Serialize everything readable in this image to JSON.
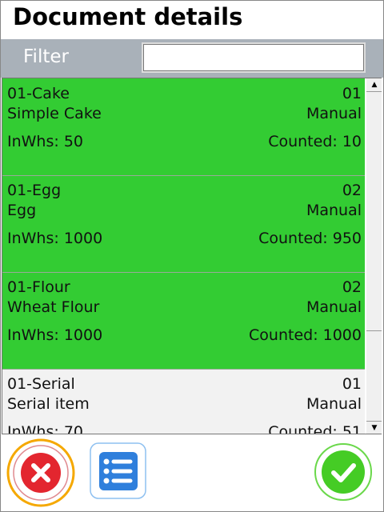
{
  "title": "Document details",
  "filter": {
    "label": "Filter",
    "value": ""
  },
  "items": [
    {
      "code": "01-Cake",
      "name": "Simple Cake",
      "num": "01",
      "mode": "Manual",
      "inwhs": "InWhs: 50",
      "counted": "Counted: 10",
      "bg": "#33cc33"
    },
    {
      "code": "01-Egg",
      "name": "Egg",
      "num": "02",
      "mode": "Manual",
      "inwhs": "InWhs: 1000",
      "counted": "Counted: 950",
      "bg": "#33cc33"
    },
    {
      "code": "01-Flour",
      "name": "Wheat Flour",
      "num": "02",
      "mode": "Manual",
      "inwhs": "InWhs: 1000",
      "counted": "Counted: 1000",
      "bg": "#33cc33"
    },
    {
      "code": "01-Serial",
      "name": "Serial item",
      "num": "01",
      "mode": "Manual",
      "inwhs": "InWhs: 70",
      "counted": "Counted: 51",
      "bg": "#f2f2f2"
    }
  ],
  "buttons": {
    "cancel": "cancel-icon",
    "list": "list-icon",
    "confirm": "check-icon"
  }
}
